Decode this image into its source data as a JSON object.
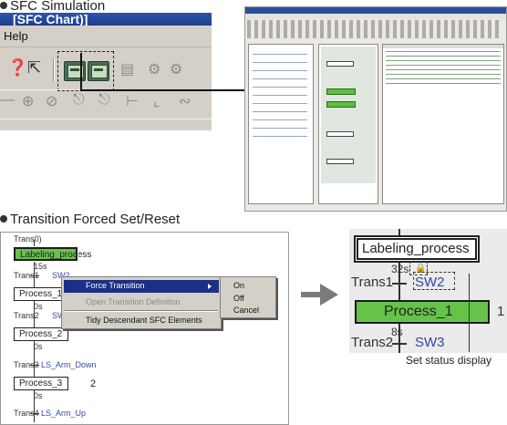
{
  "section1": {
    "heading": "SFC Simulation",
    "window_title": "[SFC Chart)]",
    "menu_help": "Help"
  },
  "section2": {
    "heading": "Transition Forced Set/Reset"
  },
  "sfc_chart": {
    "top_label": "Trans0)",
    "labeling_process": "Labeling_process",
    "time_15s": "15s",
    "trans1": "Trans1",
    "sw2": "SW2",
    "process_1": "Process_1",
    "time_0s_a": "0s",
    "trans2": "Trans2",
    "sw3": "SW3",
    "process_2": "Process_2",
    "time_0s_b": "0s",
    "trans3": "Trans3",
    "ls_arm_down": "LS_Arm_Down",
    "process_3": "Process_3",
    "process_3_num": "2",
    "time_0s_c": "0s",
    "trans4": "Trans4",
    "ls_arm_up": "LS_Arm_Up"
  },
  "context_menu": {
    "items": [
      "Force Transition",
      "Open Transition Definition",
      "Tidy Descendant SFC Elements"
    ],
    "submenu": [
      "On",
      "Off",
      "Cancel"
    ]
  },
  "zoom_detail": {
    "labeling_process": "Labeling_process",
    "time_32s": "32s",
    "trans1": "Trans1",
    "sw2": "SW2",
    "process_1": "Process_1",
    "process_1_num": "1",
    "time_8s": "8s",
    "trans2": "Trans2",
    "sw3": "SW3",
    "caption": "Set status display"
  },
  "colors": {
    "active_step": "#67c24a",
    "transition_condition": "#2f46a8",
    "menu_highlight": "#1b2f86"
  }
}
